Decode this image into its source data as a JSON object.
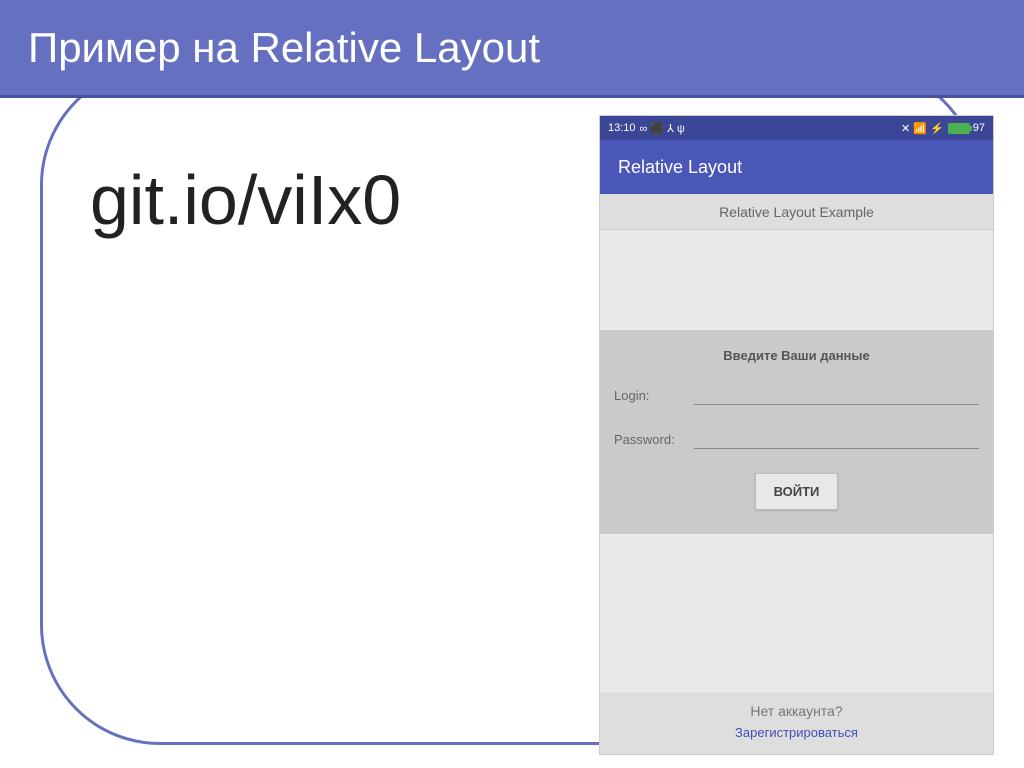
{
  "slide": {
    "title": "Пример на Relative Layout",
    "url": "git.io/viIx0"
  },
  "phone": {
    "status": {
      "time": "13:10",
      "icons": "∞ ⬛ ⅄ ψ",
      "signal": "✕ 📶 ⚡",
      "battery": "97"
    },
    "appbar": {
      "title": "Relative Layout"
    },
    "subtitle": "Relative Layout Example",
    "form": {
      "heading": "Введите Ваши данные",
      "login_label": "Login:",
      "password_label": "Password:",
      "button_label": "ВОЙТИ"
    },
    "footer": {
      "no_account": "Нет аккаунта?",
      "register": "Зарегистрироваться"
    }
  }
}
